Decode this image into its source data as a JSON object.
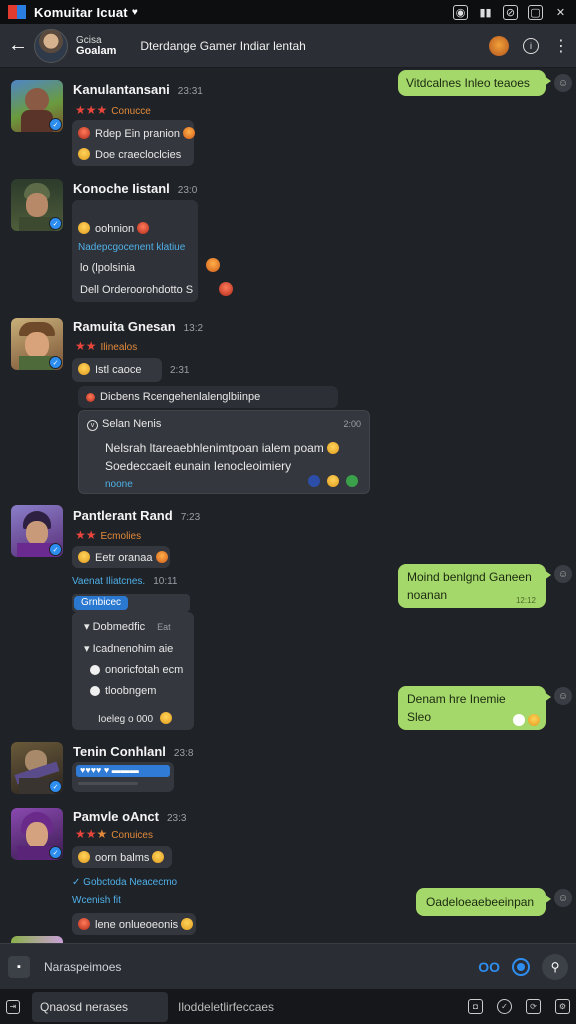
{
  "titlebar": {
    "title": "Komuitar Icuat",
    "caret": "♥"
  },
  "header": {
    "name_line1": "Gcisa",
    "name_line2": "Goalam",
    "channel": "Dterdange Gamer Indiar lentah"
  },
  "messages": {
    "m1": {
      "name": "Kanulantansani",
      "time": "23:31",
      "badge": "Conucce",
      "line1": "Rdep Ein pranion",
      "line2": "Doe craecloclcies"
    },
    "m2": {
      "name": "Konoche Iistanl",
      "time": "23:0",
      "line1": "oohnion",
      "line2": "Nadepcgocenent klatiue",
      "line3": "lo (lpolsinia",
      "line4": "Dell Orderoorohdotto S"
    },
    "m3": {
      "name": "Ramuita Gnesan",
      "time": "13:2",
      "badge": "Ilinealos",
      "line1": "Istl caoce",
      "line1_time": "2:31"
    },
    "quote": {
      "header": "Dicbens Rcengehenlalenglbiinpe",
      "author": "Selan Nenis",
      "time": "2:00",
      "text1": "Nelsrah ltareaebhlenimtpoan ialem poam",
      "text2": "Soedeccaeit eunain Ienocleoimiery",
      "footer": "noone"
    },
    "m4": {
      "name": "Pantlerant Rand",
      "time": "7:23",
      "badge": "Ecmolies",
      "line1": "Eetr oranaa",
      "sublink": "Vaenat Iliatcnes.",
      "sublink_time": "10:11"
    },
    "reply_pill": "Grnbicec",
    "list": {
      "i1": "Dobmedfic",
      "i1_time": "Eat",
      "i2": "Icadnenohim aie",
      "i3": "onoricfotah ecm",
      "i4": "tloobngem",
      "footer": "Ioeleg o 000"
    },
    "m5": {
      "name": "Tenin Conhlanl",
      "time": "23:8"
    },
    "m6": {
      "name": "Pamvle oAnct",
      "time": "23:3",
      "badge": "Conuices",
      "line1": "oorn balms",
      "sublink": "Gobctoda Neacecmo",
      "sub2": "Wcenish fit",
      "line2": "lene onlueoeonis"
    },
    "out": {
      "o1": "Vitdcalnes Inleo teaoes",
      "o2_line1": "Moind benlgnd Ganeen",
      "o2_line2": "noanan",
      "o2_time": "12:12",
      "o3_line1": "Denam hre Inemie",
      "o3_line2": "Sleo",
      "o4": "Oadeloeaebeeinpan"
    }
  },
  "composer": {
    "placeholder": "Naraspeimoes",
    "blue_label": "OO"
  },
  "bottombar": {
    "search": "Qnaosd nerases",
    "status": "Iloddeletlirfeccaes"
  },
  "colors": {
    "accent": "#2d8ef0",
    "outgoing": "#a5d86a",
    "background": "#1f2227"
  }
}
